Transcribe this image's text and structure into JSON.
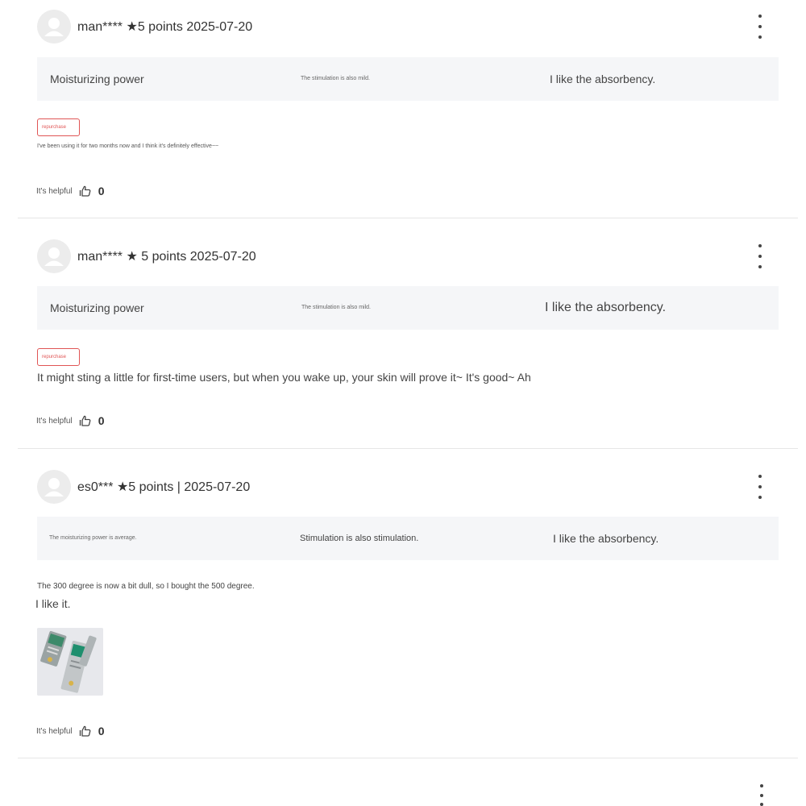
{
  "reviews": [
    {
      "user": "man****",
      "rating": "★5 points",
      "date": "2025-07-20",
      "attrs": [
        "Moisturizing power",
        "The stimulation is also mild.",
        "I like the absorbency."
      ],
      "badge": "repurchase",
      "text": "I've been using it for two months now and I think it's definitely effective~~",
      "helpful_label": "It's helpful",
      "helpful_count": "0"
    },
    {
      "user": "man****",
      "rating": "★ 5 points",
      "date": "2025-07-20",
      "attrs": [
        "Moisturizing power",
        "The stimulation is also mild.",
        "I like the absorbency."
      ],
      "badge": "repurchase",
      "text": "It might sting a little for first-time users, but when you wake up, your skin will prove it~ It's good~ Ah",
      "helpful_label": "It's helpful",
      "helpful_count": "0"
    },
    {
      "user": "es0***",
      "rating": "★5 points |",
      "date": "2025-07-20",
      "attrs": [
        "The moisturizing power is average.",
        "Stimulation is also stimulation.",
        "I like the absorbency."
      ],
      "text_line1": "The 300 degree is now a bit dull, so I bought the 500 degree.",
      "text_line2": "I like it.",
      "helpful_label": "It's helpful",
      "helpful_count": "0"
    }
  ]
}
